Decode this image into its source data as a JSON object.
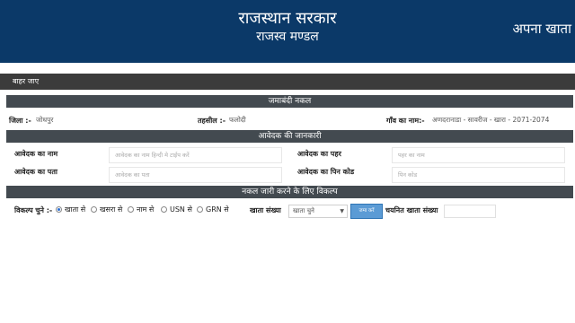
{
  "header": {
    "title": "राजस्थान सरकार",
    "subtitle": "राजस्व मण्डल",
    "brand": "अपना खाता"
  },
  "nav": {
    "logout": "बाहर जाए"
  },
  "jamabandi": {
    "section_title": "जमाबंदी नकल",
    "district_label": "जिला :-",
    "district_value": "जोधपुर",
    "tehsil_label": "तहसील :-",
    "tehsil_value": "फलोदी",
    "village_label": "गाँव का नाम:-",
    "village_value": "अणदरानाडा - सावरीज - खारा - 2071-2074"
  },
  "applicant": {
    "section_title": "आवेदक की जानकारी",
    "name_label": "आवेदक का नाम",
    "name_placeholder": "आवेदक का नाम हिन्दी मे टाईप करें",
    "father_label": "आवेदक का पहर",
    "father_placeholder": "पहर का नाम",
    "address_label": "आवेदक का पता",
    "address_placeholder": "आवेदक का पता",
    "pincode_label": "आवेदक का पिन कोड",
    "pincode_placeholder": "पिन कोड"
  },
  "options": {
    "section_title": "नकल जारी करने के लिए विकल्प",
    "choose_label": "विकल्प चुने :-",
    "radios": [
      "खाता से",
      "खसरा से",
      "नाम से",
      "USN से",
      "GRN से"
    ],
    "account_no_label": "खाता संख्या",
    "account_select_value": "खाता चुने",
    "add_button": "जमा करें",
    "selected_account_label": "चयनित खाता संख्या"
  }
}
